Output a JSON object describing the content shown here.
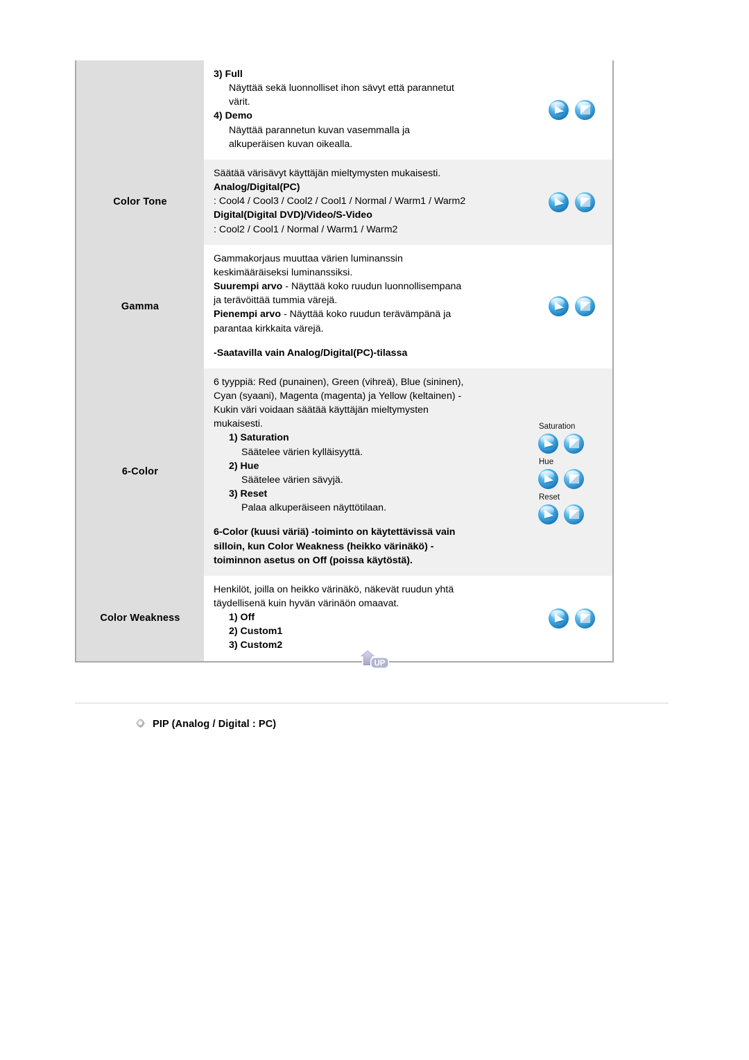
{
  "table": {
    "rows": [
      {
        "label": "",
        "label_visible": false,
        "body": {
          "items": [
            {
              "kind": "heading",
              "text": "3) Full"
            },
            {
              "kind": "indent",
              "text": "Näyttää sekä luonnolliset ihon sävyt että parannetut"
            },
            {
              "kind": "indent",
              "text": "värit."
            },
            {
              "kind": "heading",
              "text": "4) Demo"
            },
            {
              "kind": "indent",
              "text": "Näyttää parannetun kuvan vasemmalla ja"
            },
            {
              "kind": "indent",
              "text": "alkuperäisen kuvan oikealla."
            }
          ]
        },
        "bg": "white",
        "icons": {
          "type": "pair",
          "groups": [
            {
              "caption": "",
              "buttons": [
                "play-icon",
                "enter-icon"
              ]
            }
          ]
        }
      },
      {
        "label": "Color Tone",
        "label_visible": true,
        "body": {
          "items": [
            {
              "kind": "plain",
              "text": "Säätää värisävyt käyttäjän mieltymysten mukaisesti."
            },
            {
              "kind": "bold",
              "text": "Analog/Digital(PC)"
            },
            {
              "kind": "plain",
              "text": ": Cool4 / Cool3 / Cool2 / Cool1 / Normal / Warm1 / Warm2"
            },
            {
              "kind": "bold",
              "text": "Digital(Digital DVD)/Video/S-Video"
            },
            {
              "kind": "plain",
              "text": ": Cool2 / Cool1 / Normal / Warm1 / Warm2"
            }
          ]
        },
        "bg": "grey",
        "icons": {
          "type": "pair",
          "groups": [
            {
              "caption": "",
              "buttons": [
                "play-icon",
                "enter-icon"
              ]
            }
          ]
        }
      },
      {
        "label": "Gamma",
        "label_visible": true,
        "body": {
          "items": [
            {
              "kind": "plain",
              "text": "Gammakorjaus muuttaa värien luminanssin"
            },
            {
              "kind": "plain",
              "text": "keskimääräiseksi luminanssiksi."
            },
            {
              "kind": "mixed",
              "bold": "Suurempi arvo",
              "rest": " - Näyttää koko ruudun luonnollisempana"
            },
            {
              "kind": "plain",
              "text": "ja terävöittää tummia värejä."
            },
            {
              "kind": "mixed",
              "bold": "Pienempi arvo",
              "rest": " - Näyttää koko ruudun terävämpänä ja"
            },
            {
              "kind": "plain",
              "text": "parantaa kirkkaita värejä."
            },
            {
              "kind": "spacer",
              "text": ""
            },
            {
              "kind": "bold",
              "text": "-Saatavilla vain Analog/Digital(PC)-tilassa"
            }
          ]
        },
        "bg": "white",
        "icons": {
          "type": "pair",
          "groups": [
            {
              "caption": "",
              "buttons": [
                "play-icon",
                "enter-icon"
              ]
            }
          ]
        }
      },
      {
        "label": "6-Color",
        "label_visible": true,
        "body": {
          "items": [
            {
              "kind": "plain",
              "text": "6 tyyppiä: Red (punainen), Green (vihreä), Blue (sininen),"
            },
            {
              "kind": "plain",
              "text": "Cyan (syaani), Magenta (magenta) ja Yellow (keltainen) -"
            },
            {
              "kind": "plain",
              "text": "Kukin väri voidaan säätää käyttäjän mieltymysten"
            },
            {
              "kind": "plain",
              "text": "mukaisesti."
            },
            {
              "kind": "heading",
              "text": "1) Saturation"
            },
            {
              "kind": "sub",
              "text": "Säätelee värien kylläisyyttä."
            },
            {
              "kind": "heading",
              "text": "2) Hue"
            },
            {
              "kind": "sub",
              "text": "Säätelee värien sävyjä."
            },
            {
              "kind": "heading",
              "text": "3) Reset"
            },
            {
              "kind": "sub",
              "text": "Palaa alkuperäiseen näyttötilaan."
            },
            {
              "kind": "spacer",
              "text": ""
            },
            {
              "kind": "bold",
              "text": "6-Color (kuusi väriä) -toiminto on käytettävissä vain"
            },
            {
              "kind": "bold",
              "text": "silloin, kun Color Weakness (heikko värinäkö) -"
            },
            {
              "kind": "bold",
              "text": "toiminnon asetus on Off (poissa käytöstä)."
            }
          ]
        },
        "bg": "grey",
        "icons": {
          "type": "captioned",
          "groups": [
            {
              "caption": "Saturation",
              "buttons": [
                "play-icon",
                "enter-icon"
              ]
            },
            {
              "caption": "Hue",
              "buttons": [
                "play-icon",
                "enter-icon"
              ]
            },
            {
              "caption": "Reset",
              "buttons": [
                "play-icon",
                "enter-icon"
              ]
            }
          ]
        }
      },
      {
        "label": "Color Weakness",
        "label_visible": true,
        "body": {
          "items": [
            {
              "kind": "plain",
              "text": "Henkilöt, joilla on heikko värinäkö, näkevät ruudun yhtä"
            },
            {
              "kind": "plain",
              "text": "täydellisenä kuin hyvän värinäön omaavat."
            },
            {
              "kind": "heading",
              "text": "1) Off"
            },
            {
              "kind": "heading",
              "text": "2) Custom1"
            },
            {
              "kind": "heading",
              "text": "3) Custom2"
            }
          ]
        },
        "bg": "white",
        "icons": {
          "type": "pair",
          "groups": [
            {
              "caption": "",
              "buttons": [
                "play-icon",
                "enter-icon"
              ]
            }
          ]
        }
      }
    ]
  },
  "up_button": {
    "label": "UP",
    "icon": "up-arrow-icon"
  },
  "pip_section": {
    "bullet_icon": "diamond-bullet-icon",
    "title": "PIP (Analog / Digital : PC)"
  },
  "colors": {
    "label_cell_bg": "#dedede",
    "body_grey_bg": "#f0f0f0",
    "body_white_bg": "#ffffff",
    "table_border": "#a8a8a8",
    "divider": "#d4d4d4",
    "button_blue": "#2e9ad6",
    "up_arrow": "#9a9cc8"
  }
}
